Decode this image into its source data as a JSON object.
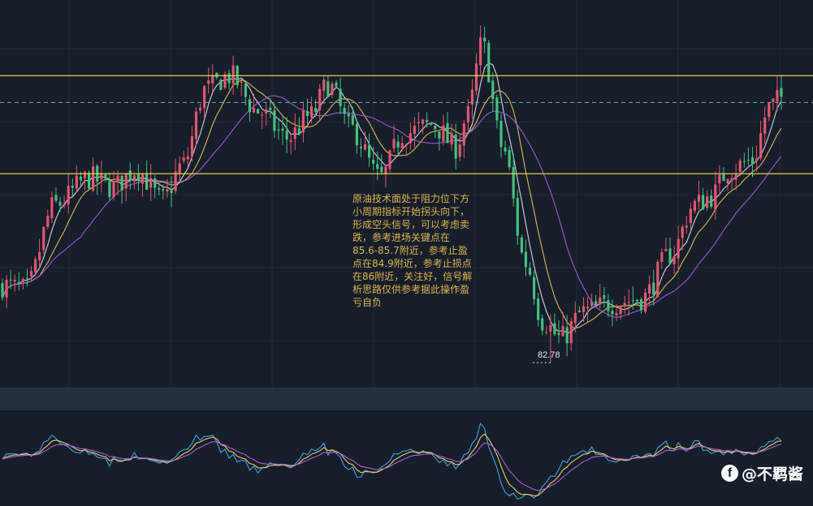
{
  "chart_data": [
    {
      "type": "candlestick",
      "subtype": "price chart with moving averages",
      "candle_count": 190,
      "min_label": "82.78",
      "min_price": 82.78,
      "resistance_level": 86.0,
      "dashed_level": 85.7,
      "support_level": 84.9,
      "ylim": [
        82.5,
        86.85
      ],
      "moving_averages": [
        "white",
        "yellow",
        "purple"
      ],
      "up_color": "#e8556c",
      "down_color": "#3fc57e",
      "grid": true,
      "annotation": "原油技术面处于阻力位下方小周期指标开始拐头向下，形成空头信号，可以考虑卖跌，参考进场关键点在85.6-85.7附近，参考止盈点在84.9附近，参考止损点在86附近，关注好，信号解析思路仅供参考据此操作盈亏自负"
    },
    {
      "type": "line",
      "subtype": "oscillator",
      "series": [
        {
          "color": "#3aa6e8"
        },
        {
          "color": "#f0d060"
        },
        {
          "color": "#b15fd6"
        }
      ]
    }
  ],
  "watermark": {
    "icon": "facebook-icon",
    "text": "@不羁酱"
  },
  "colors": {
    "background": "#161d2b",
    "separator": "#262f3e",
    "level_line": "#e6d23a",
    "dashed_line": "#56b8ad",
    "grid": "#222a3a"
  }
}
